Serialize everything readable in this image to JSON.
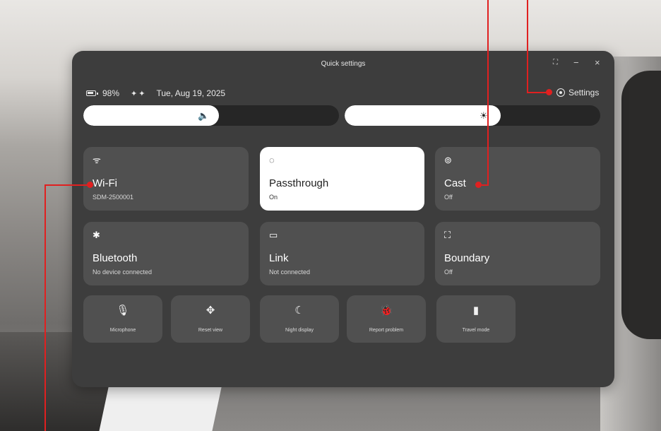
{
  "window": {
    "title": "Quick settings",
    "controls": {
      "expand": "⛶",
      "minimize": "−",
      "close": "×"
    }
  },
  "status": {
    "battery": "98%",
    "controllers_icon": "controllers-icon",
    "datetime": "Tue, Aug 19, 2025",
    "settings_label": "Settings"
  },
  "sliders": {
    "volume": {
      "icon": "speaker-icon",
      "glyph": "🔈",
      "level": 0.53
    },
    "brightness": {
      "icon": "brightness-icon",
      "glyph": "☀",
      "level": 0.61
    }
  },
  "tiles": [
    {
      "name": "wifi",
      "icon": "wifi-icon",
      "glyph": "ᯤ",
      "label": "Wi-Fi",
      "sub": "SDM-2500001",
      "active": false
    },
    {
      "name": "passthrough",
      "icon": "passthrough-icon",
      "glyph": "◌",
      "label": "Passthrough",
      "sub": "On",
      "active": true
    },
    {
      "name": "cast",
      "icon": "cast-icon",
      "glyph": "⊚",
      "label": "Cast",
      "sub": "Off",
      "active": false
    },
    {
      "name": "bluetooth",
      "icon": "bluetooth-icon",
      "glyph": "✱",
      "label": "Bluetooth",
      "sub": "No device connected",
      "active": false
    },
    {
      "name": "link",
      "icon": "link-icon",
      "glyph": "▭",
      "label": "Link",
      "sub": "Not connected",
      "active": false
    },
    {
      "name": "boundary",
      "icon": "boundary-icon",
      "glyph": "⛶",
      "label": "Boundary",
      "sub": "Off",
      "active": false
    }
  ],
  "small_tiles": [
    {
      "name": "microphone",
      "icon": "microphone-icon",
      "glyph": "🎙",
      "label": "Microphone"
    },
    {
      "name": "reset-view",
      "icon": "move-icon",
      "glyph": "✥",
      "label": "Reset view"
    },
    {
      "name": "night-display",
      "icon": "moon-icon",
      "glyph": "☾",
      "label": "Night display"
    },
    {
      "name": "report-problem",
      "icon": "bug-icon",
      "glyph": "🐞",
      "label": "Report problem"
    },
    {
      "name": "travel-mode",
      "icon": "luggage-icon",
      "glyph": "▮",
      "label": "Travel mode"
    }
  ],
  "colors": {
    "panel": "#3d3d3d",
    "tile": "#505050",
    "active_tile": "#ffffff",
    "annotation": "#e02020"
  }
}
